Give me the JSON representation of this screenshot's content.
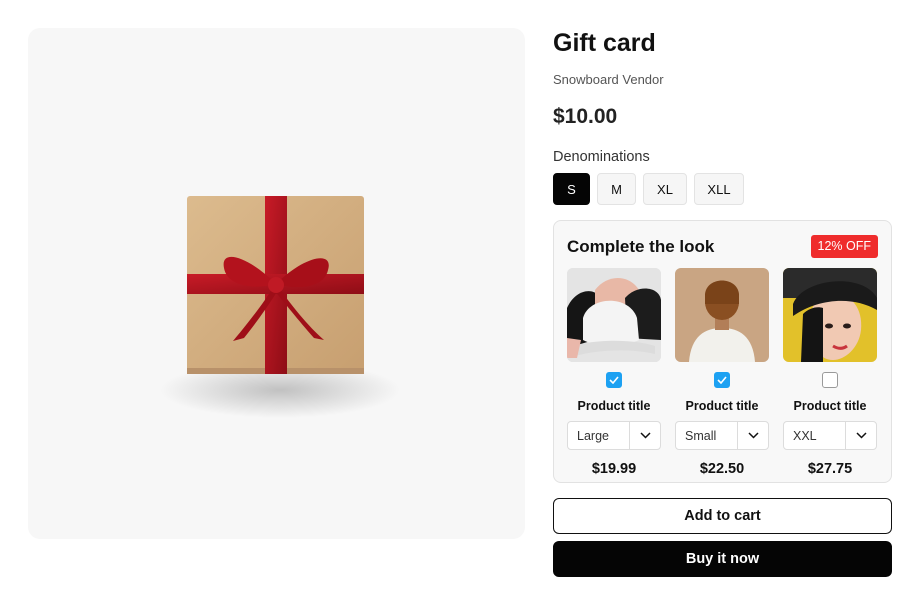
{
  "product": {
    "title": "Gift card",
    "vendor": "Snowboard Vendor",
    "price": "$10.00",
    "image_icon": "gift-box-icon"
  },
  "options": {
    "label": "Denominations",
    "values": [
      "S",
      "M",
      "XL",
      "XLL"
    ],
    "selected": "S"
  },
  "bundle": {
    "title": "Complete the look",
    "badge": "12% OFF",
    "items": [
      {
        "title": "Product title",
        "variant": "Large",
        "price": "$19.99",
        "checked": true,
        "image": "baseball-caps-photo"
      },
      {
        "title": "Product title",
        "variant": "Small",
        "price": "$22.50",
        "checked": true,
        "image": "beanie-photo"
      },
      {
        "title": "Product title",
        "variant": "XXL",
        "price": "$27.75",
        "checked": false,
        "image": "bucket-hat-photo"
      }
    ]
  },
  "actions": {
    "add_to_cart": "Add to cart",
    "buy_now": "Buy it now"
  },
  "colors": {
    "accent": "#050505",
    "badge": "#ef2c2c",
    "checkbox": "#1da1f2",
    "ribbon": "#b3121d",
    "box": "#d2ad7e"
  }
}
